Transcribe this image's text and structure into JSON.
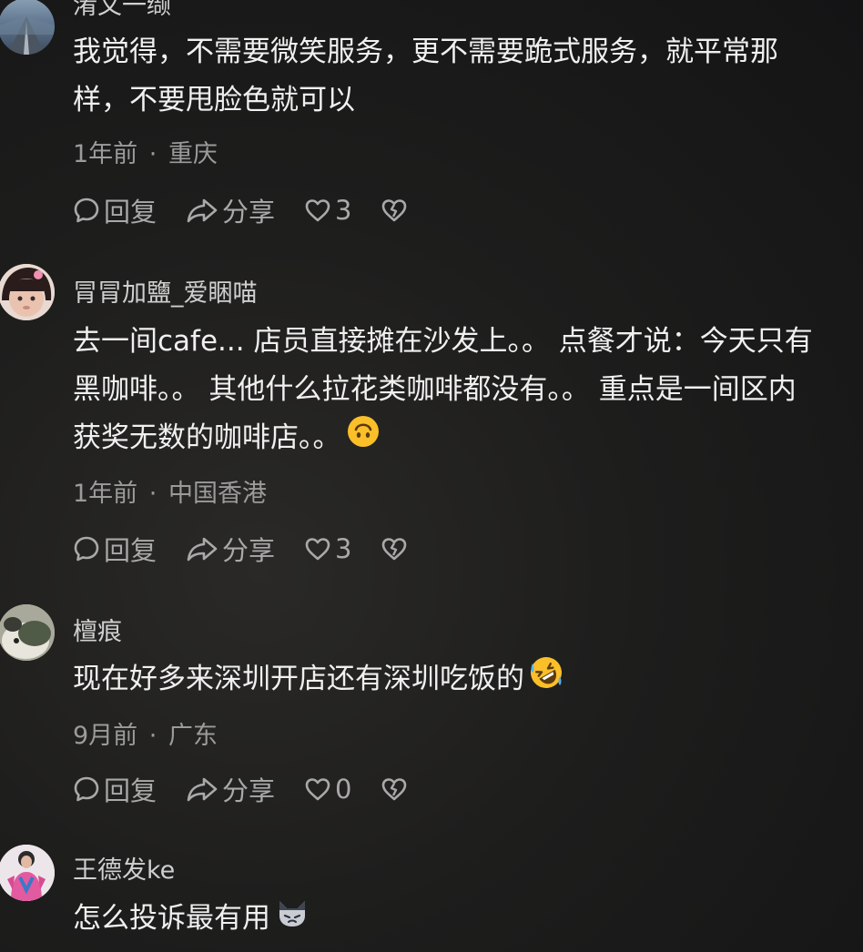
{
  "comments": [
    {
      "username": "淆文一缬",
      "text_lines": [
        "我觉得，不需要微笑服务，更不需要跪式服务，就平常那",
        "样，不要甩脸色就可以"
      ],
      "time": "1年前",
      "location": "重庆",
      "reply_label": "回复",
      "share_label": "分享",
      "likes": "3"
    },
    {
      "username": "冐冐加鹽_爱睏喵",
      "text_lines": [
        "去一间cafe... 店员直接摊在沙发上。。 点餐才说：今天只有",
        "黑咖啡。。 其他什么拉花类咖啡都没有。。 重点是一间区内",
        "获奖无数的咖啡店。。"
      ],
      "emoji": "upside-down-face-emoji",
      "time": "1年前",
      "location": "中国香港",
      "reply_label": "回复",
      "share_label": "分享",
      "likes": "3"
    },
    {
      "username": "檀痕",
      "text_lines": [
        "现在好多来深圳开店还有深圳吃饭的"
      ],
      "emoji": "rolling-laughing-emoji",
      "time": "9月前",
      "location": "广东",
      "reply_label": "回复",
      "share_label": "分享",
      "likes": "0"
    },
    {
      "username": "王德发ke",
      "text_lines": [
        "怎么投诉最有用"
      ],
      "emoji": "cat-emoji"
    }
  ],
  "meta_separator": "·",
  "colors": {
    "background": "#1d1d1c",
    "text": "#f0f0f0",
    "meta": "#9b9b9b",
    "icon": "#a9a9a9"
  }
}
